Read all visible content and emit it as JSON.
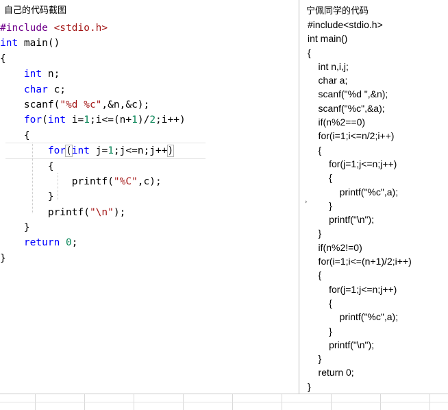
{
  "captions": {
    "left": "自己的代码截图",
    "right": "宁佩同学的代码"
  },
  "left_code": {
    "lines": [
      [
        {
          "t": "#include ",
          "c": "pp"
        },
        {
          "t": "<stdio.h>",
          "c": "str"
        }
      ],
      [
        {
          "t": "int",
          "c": "kw"
        },
        {
          "t": " main()",
          "c": "txt"
        }
      ],
      [
        {
          "t": "{",
          "c": "txt"
        }
      ],
      [
        {
          "t": "    ",
          "c": "txt"
        },
        {
          "t": "int",
          "c": "kw"
        },
        {
          "t": " n;",
          "c": "txt"
        }
      ],
      [
        {
          "t": "    ",
          "c": "txt"
        },
        {
          "t": "char",
          "c": "kw"
        },
        {
          "t": " c;",
          "c": "txt"
        }
      ],
      [
        {
          "t": "    scanf(",
          "c": "txt"
        },
        {
          "t": "\"%d %c\"",
          "c": "str"
        },
        {
          "t": ",&n,&c);",
          "c": "txt"
        }
      ],
      [
        {
          "t": "    ",
          "c": "txt"
        },
        {
          "t": "for",
          "c": "kw"
        },
        {
          "t": "(",
          "c": "txt"
        },
        {
          "t": "int",
          "c": "kw"
        },
        {
          "t": " i=",
          "c": "txt"
        },
        {
          "t": "1",
          "c": "num"
        },
        {
          "t": ";i<=(n+",
          "c": "txt"
        },
        {
          "t": "1",
          "c": "num"
        },
        {
          "t": ")/",
          "c": "txt"
        },
        {
          "t": "2",
          "c": "num"
        },
        {
          "t": ";i++)",
          "c": "txt"
        }
      ],
      [
        {
          "t": "    {",
          "c": "txt"
        }
      ],
      [
        {
          "t": "        ",
          "c": "txt"
        },
        {
          "t": "for",
          "c": "kw"
        },
        {
          "t": "(",
          "c": "txt",
          "box": true
        },
        {
          "t": "int",
          "c": "kw"
        },
        {
          "t": " j=",
          "c": "txt"
        },
        {
          "t": "1",
          "c": "num"
        },
        {
          "t": ";j<=n;j++",
          "c": "txt"
        },
        {
          "t": ")",
          "c": "txt",
          "box": true
        }
      ],
      [
        {
          "t": "        {",
          "c": "txt"
        }
      ],
      [
        {
          "t": "            printf(",
          "c": "txt"
        },
        {
          "t": "\"%C\"",
          "c": "str"
        },
        {
          "t": ",c);",
          "c": "txt"
        }
      ],
      [
        {
          "t": "        }",
          "c": "txt"
        }
      ],
      [
        {
          "t": "        printf(",
          "c": "txt"
        },
        {
          "t": "\"\\n\"",
          "c": "str"
        },
        {
          "t": ");",
          "c": "txt"
        }
      ],
      [
        {
          "t": "    }",
          "c": "txt"
        }
      ],
      [
        {
          "t": "    ",
          "c": "txt"
        },
        {
          "t": "return",
          "c": "kw"
        },
        {
          "t": " ",
          "c": "txt"
        },
        {
          "t": "0",
          "c": "num"
        },
        {
          "t": ";",
          "c": "txt"
        }
      ],
      [
        {
          "t": "}",
          "c": "txt"
        }
      ]
    ]
  },
  "right_code": {
    "lines": [
      "#include<stdio.h>",
      "int main()",
      "{",
      "    int n,i,j;",
      "    char a;",
      "    scanf(\"%d \",&n);",
      "    scanf(\"%c\",&a);",
      "    if(n%2==0)",
      "    for(i=1;i<=n/2;i++)",
      "    {",
      "        for(j=1;j<=n;j++)",
      "        {",
      "            printf(\"%c\",a);",
      "        }",
      "        printf(\"\\n\");",
      "    }",
      "    if(n%2!=0)",
      "    for(i=1;i<=(n+1)/2;i++)",
      "    {",
      "        for(j=1;j<=n;j++)",
      "        {",
      "            printf(\"%c\",a);",
      "        }",
      "        printf(\"\\n\");",
      "    }",
      "    return 0;",
      "}"
    ]
  },
  "colors": {
    "keyword": "#0000ff",
    "preprocessor": "#6f008a",
    "string": "#a31515",
    "number": "#098658"
  }
}
